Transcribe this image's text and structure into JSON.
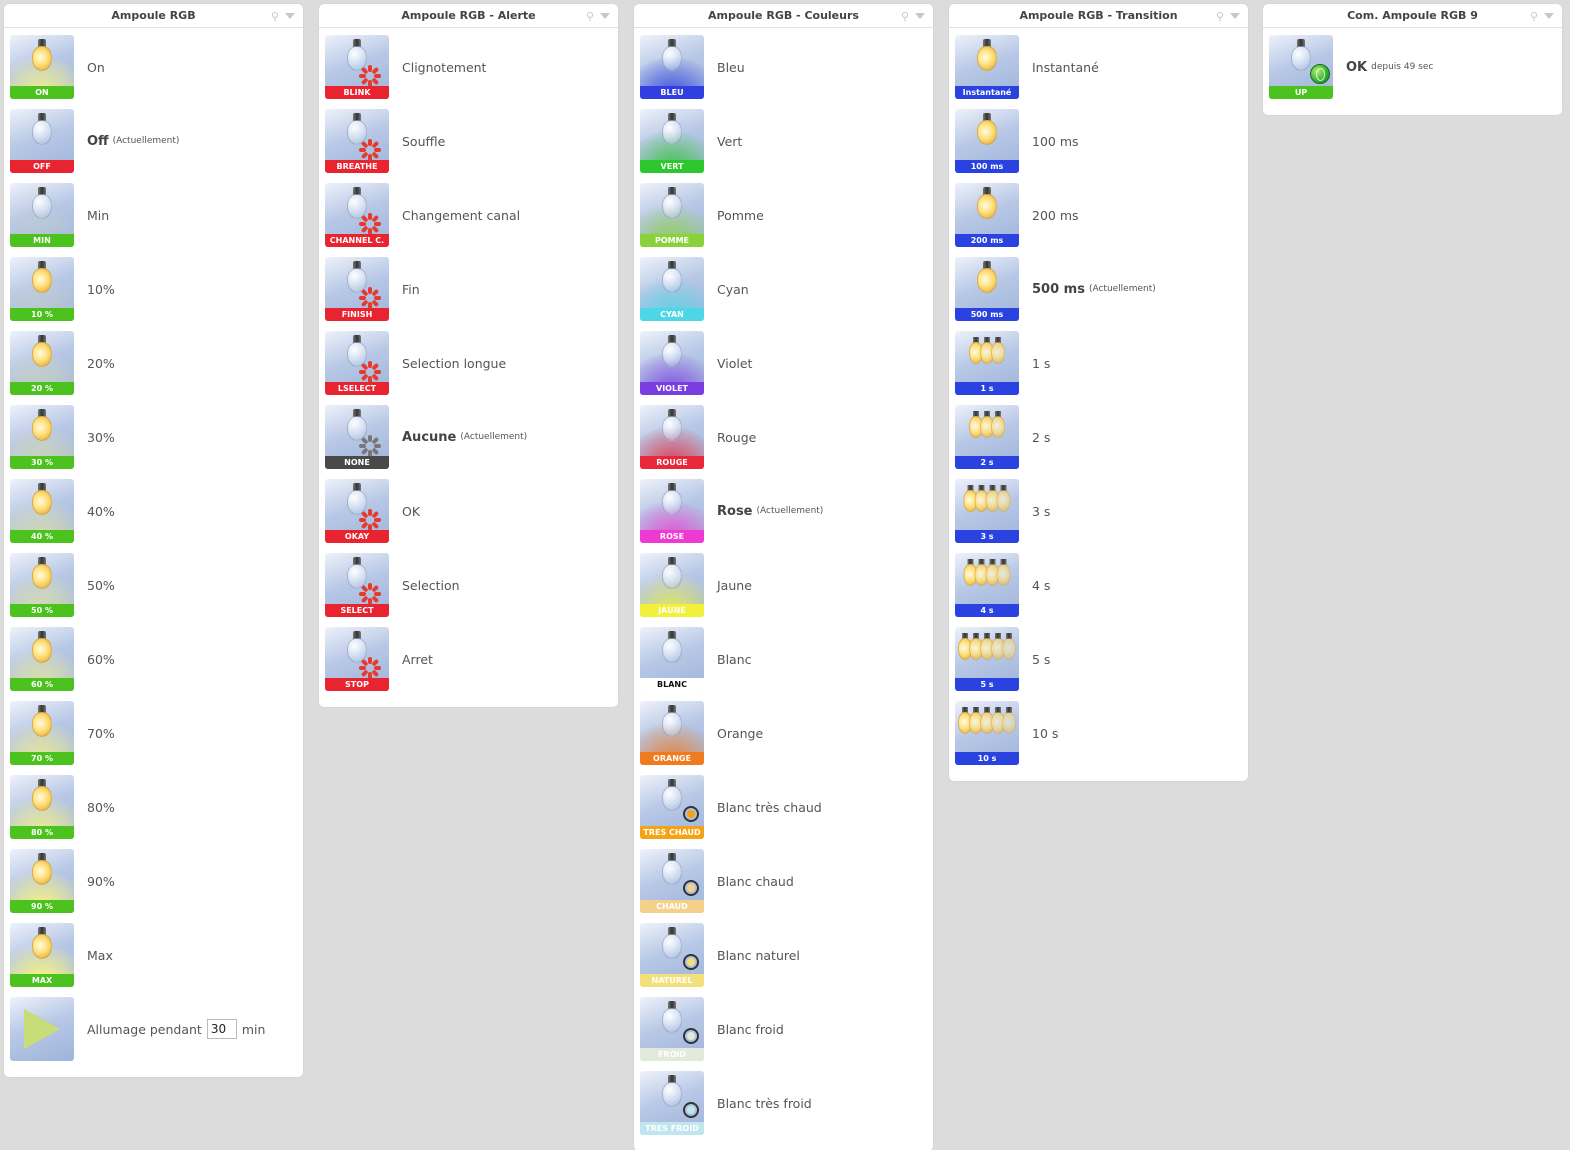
{
  "colors": {
    "green": "#4cc21e",
    "red": "#e82431",
    "blue": "#2a43e0",
    "dark": "#494949"
  },
  "panels": {
    "rgb": {
      "title": "Ampoule RGB",
      "rows": [
        {
          "badge": "ON",
          "label": "On"
        },
        {
          "badge": "OFF",
          "label": "Off",
          "current": "(Actuellement)"
        },
        {
          "badge": "MIN",
          "label": "Min"
        },
        {
          "badge": "10 %",
          "label": "10%"
        },
        {
          "badge": "20 %",
          "label": "20%"
        },
        {
          "badge": "30 %",
          "label": "30%"
        },
        {
          "badge": "40 %",
          "label": "40%"
        },
        {
          "badge": "50 %",
          "label": "50%"
        },
        {
          "badge": "60 %",
          "label": "60%"
        },
        {
          "badge": "70 %",
          "label": "70%"
        },
        {
          "badge": "80 %",
          "label": "80%"
        },
        {
          "badge": "90 %",
          "label": "90%"
        },
        {
          "badge": "MAX",
          "label": "Max"
        }
      ],
      "timer": {
        "label_before": "Allumage pendant",
        "value": "30",
        "label_after": "min"
      }
    },
    "alert": {
      "title": "Ampoule RGB - Alerte",
      "rows": [
        {
          "badge": "BLINK",
          "label": "Clignotement"
        },
        {
          "badge": "BREATHE",
          "label": "Souffle"
        },
        {
          "badge": "CHANNEL C.",
          "label": "Changement canal"
        },
        {
          "badge": "FINISH",
          "label": "Fin"
        },
        {
          "badge": "LSELECT",
          "label": "Selection longue"
        },
        {
          "badge": "NONE",
          "label": "Aucune",
          "current": "(Actuellement)"
        },
        {
          "badge": "OKAY",
          "label": "OK"
        },
        {
          "badge": "SELECT",
          "label": "Selection"
        },
        {
          "badge": "STOP",
          "label": "Arret"
        }
      ]
    },
    "colors": {
      "title": "Ampoule RGB - Couleurs",
      "rows": [
        {
          "badge": "BLEU",
          "label": "Bleu",
          "color": "#2f3fe0"
        },
        {
          "badge": "VERT",
          "label": "Vert",
          "color": "#2ec62e"
        },
        {
          "badge": "POMME",
          "label": "Pomme",
          "color": "#8ad23c"
        },
        {
          "badge": "CYAN",
          "label": "Cyan",
          "color": "#4fd6e6"
        },
        {
          "badge": "VIOLET",
          "label": "Violet",
          "color": "#7a3ee0"
        },
        {
          "badge": "ROUGE",
          "label": "Rouge",
          "color": "#e8283a"
        },
        {
          "badge": "ROSE",
          "label": "Rose",
          "current": "(Actuellement)",
          "color": "#ee3ad0"
        },
        {
          "badge": "JAUNE",
          "label": "Jaune",
          "color": "#f2f03a"
        },
        {
          "badge": "BLANC",
          "label": "Blanc",
          "color": "#ffffff"
        },
        {
          "badge": "ORANGE",
          "label": "Orange",
          "color": "#f07a1e"
        },
        {
          "badge": "TRES CHAUD",
          "label": "Blanc très chaud",
          "color": "#f5a316"
        },
        {
          "badge": "CHAUD",
          "label": "Blanc chaud",
          "color": "#f4d08a"
        },
        {
          "badge": "NATUREL",
          "label": "Blanc naturel",
          "color": "#f3e07a"
        },
        {
          "badge": "FROID",
          "label": "Blanc froid",
          "color": "#e2eadc"
        },
        {
          "badge": "TRES FROID",
          "label": "Blanc très froid",
          "color": "#bfe6ee"
        }
      ]
    },
    "transition": {
      "title": "Ampoule RGB - Transition",
      "rows": [
        {
          "badge": "Instantané",
          "label": "Instantané",
          "bulbs": 1
        },
        {
          "badge": "100 ms",
          "label": "100 ms",
          "bulbs": 1
        },
        {
          "badge": "200 ms",
          "label": "200 ms",
          "bulbs": 1
        },
        {
          "badge": "500 ms",
          "label": "500 ms",
          "current": "(Actuellement)",
          "bulbs": 1
        },
        {
          "badge": "1 s",
          "label": "1 s",
          "bulbs": 3
        },
        {
          "badge": "2 s",
          "label": "2 s",
          "bulbs": 3
        },
        {
          "badge": "3 s",
          "label": "3 s",
          "bulbs": 4
        },
        {
          "badge": "4 s",
          "label": "4 s",
          "bulbs": 4
        },
        {
          "badge": "5 s",
          "label": "5 s",
          "bulbs": 5
        },
        {
          "badge": "10 s",
          "label": "10 s",
          "bulbs": 5
        }
      ]
    },
    "com": {
      "title": "Com. Ampoule RGB 9",
      "rows": [
        {
          "badge": "UP",
          "label": "OK",
          "current": "depuis 49 sec"
        }
      ]
    }
  },
  "icons": {
    "search": "magnifier-icon",
    "menu": "dropdown-arrow-icon",
    "bulb": "light-bulb-icon",
    "blink": "blink-burst-icon",
    "play": "play-icon",
    "globe": "globe-icon"
  }
}
